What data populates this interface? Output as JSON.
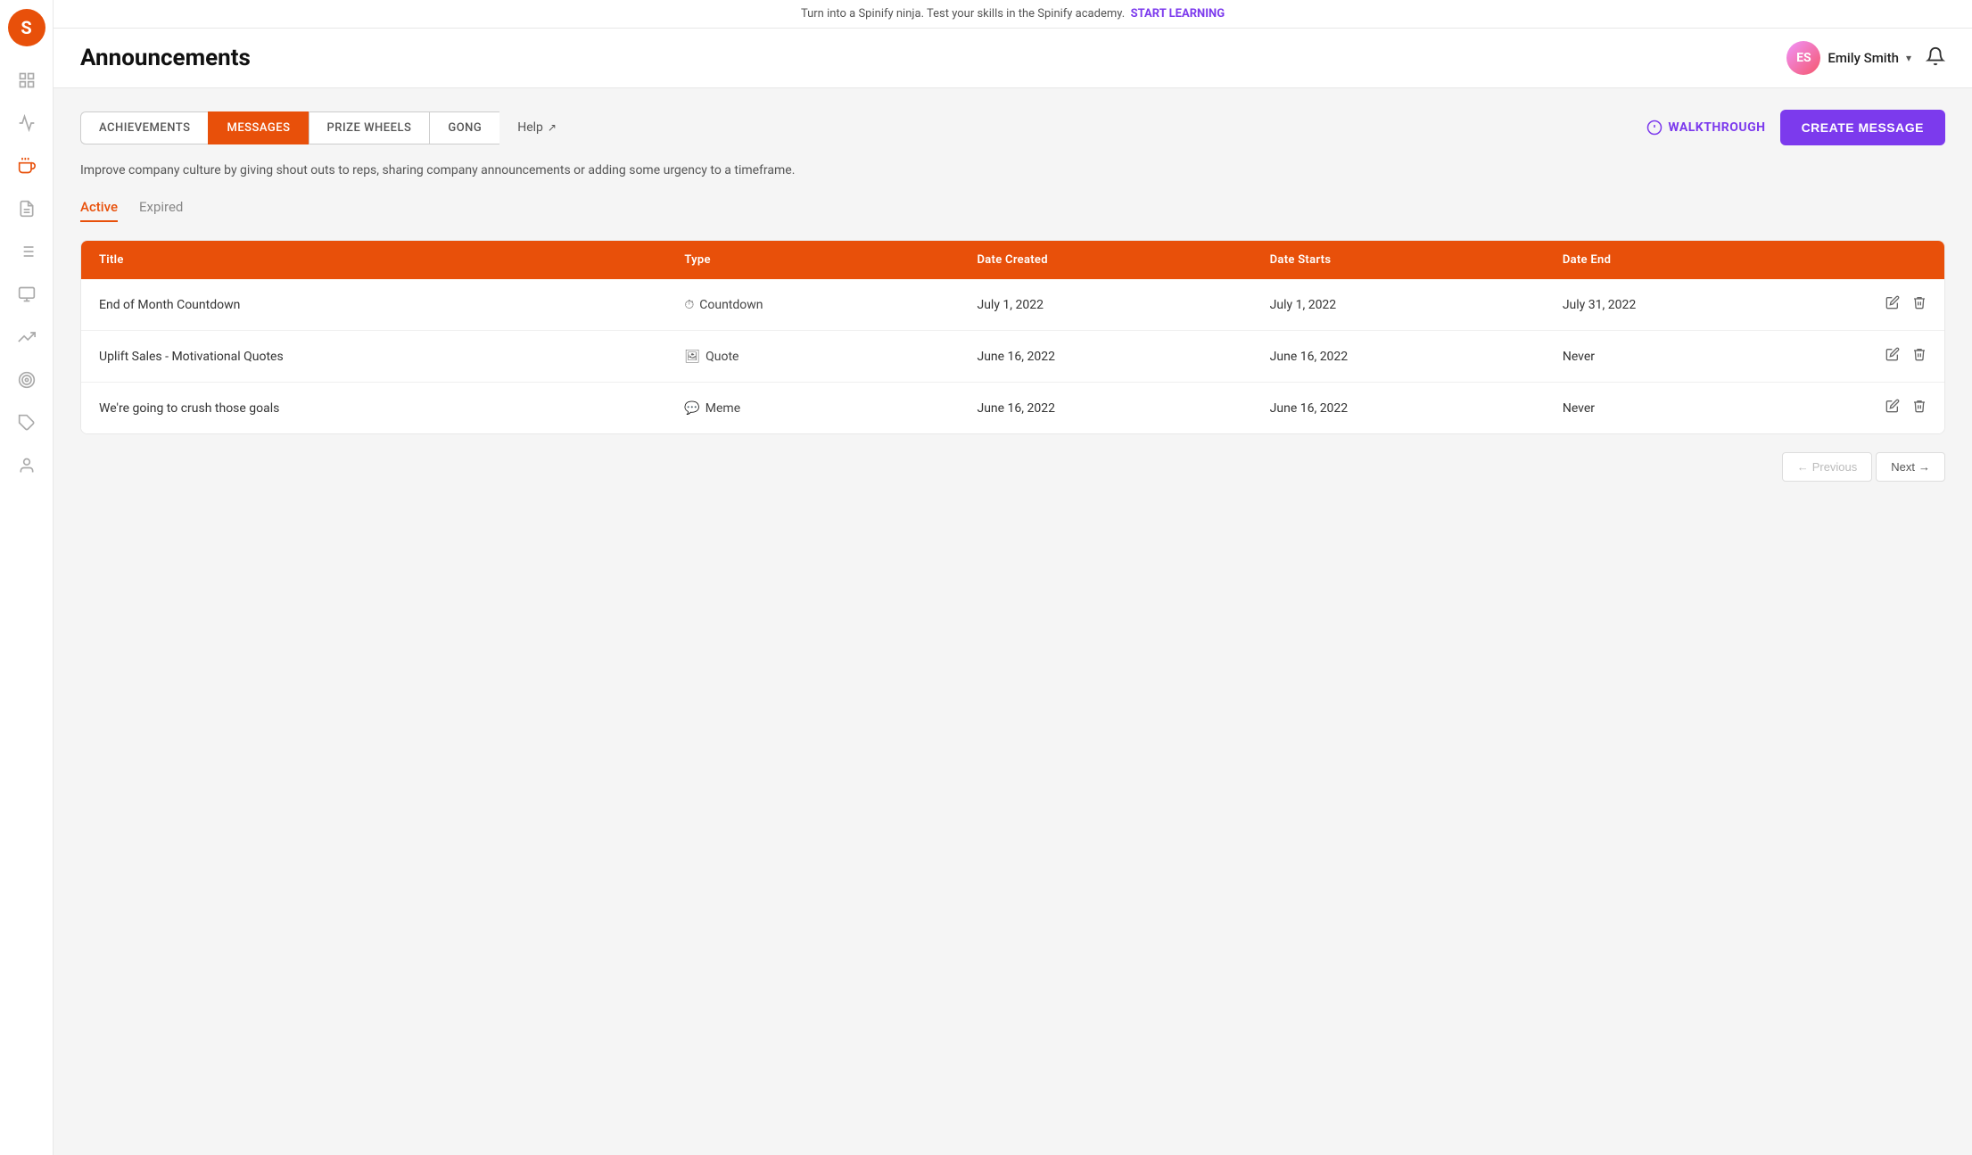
{
  "app": {
    "logo_letter": "S"
  },
  "banner": {
    "text": "Turn into a Spinify ninja. Test your skills in the Spinify academy.",
    "cta": "START LEARNING"
  },
  "header": {
    "title": "Announcements",
    "user": {
      "name": "Emily Smith",
      "initials": "ES"
    },
    "bell_label": "notifications"
  },
  "tabs": [
    {
      "id": "achievements",
      "label": "ACHIEVEMENTS",
      "active": false
    },
    {
      "id": "messages",
      "label": "MESSAGES",
      "active": true
    },
    {
      "id": "prize-wheels",
      "label": "PRIZE WHEELS",
      "active": false
    },
    {
      "id": "gong",
      "label": "GONG",
      "active": false
    }
  ],
  "help_label": "Help",
  "walkthrough_label": "WALKTHROUGH",
  "create_message_label": "CREATE MESSAGE",
  "description": "Improve company culture by giving shout outs to reps, sharing company announcements or adding some urgency to a timeframe.",
  "filter_tabs": [
    {
      "id": "active",
      "label": "Active",
      "active": true
    },
    {
      "id": "expired",
      "label": "Expired",
      "active": false
    }
  ],
  "table": {
    "headers": [
      "Title",
      "Type",
      "Date Created",
      "Date Starts",
      "Date End"
    ],
    "rows": [
      {
        "title": "End of Month Countdown",
        "type": "Countdown",
        "type_icon": "⏱",
        "date_created": "July 1, 2022",
        "date_starts": "July 1, 2022",
        "date_end": "July 31, 2022"
      },
      {
        "title": "Uplift Sales - Motivational Quotes",
        "type": "Quote",
        "type_icon": "🖼",
        "date_created": "June 16, 2022",
        "date_starts": "June 16, 2022",
        "date_end": "Never"
      },
      {
        "title": "We're going to crush those goals",
        "type": "Meme",
        "type_icon": "💬",
        "date_created": "June 16, 2022",
        "date_starts": "June 16, 2022",
        "date_end": "Never"
      }
    ]
  },
  "pagination": {
    "previous_label": "Previous",
    "next_label": "Next"
  },
  "sidebar_icons": [
    {
      "name": "dashboard-icon",
      "symbol": "▦"
    },
    {
      "name": "gauge-icon",
      "symbol": "◎"
    },
    {
      "name": "megaphone-icon",
      "symbol": "📣",
      "active": true
    },
    {
      "name": "chart-icon",
      "symbol": "📊"
    },
    {
      "name": "list-icon",
      "symbol": "☰"
    },
    {
      "name": "monitor-icon",
      "symbol": "🖥"
    },
    {
      "name": "trending-icon",
      "symbol": "↗"
    },
    {
      "name": "target-icon",
      "symbol": "⊙"
    },
    {
      "name": "puzzle-icon",
      "symbol": "⬡"
    },
    {
      "name": "user-icon",
      "symbol": "👤"
    }
  ]
}
